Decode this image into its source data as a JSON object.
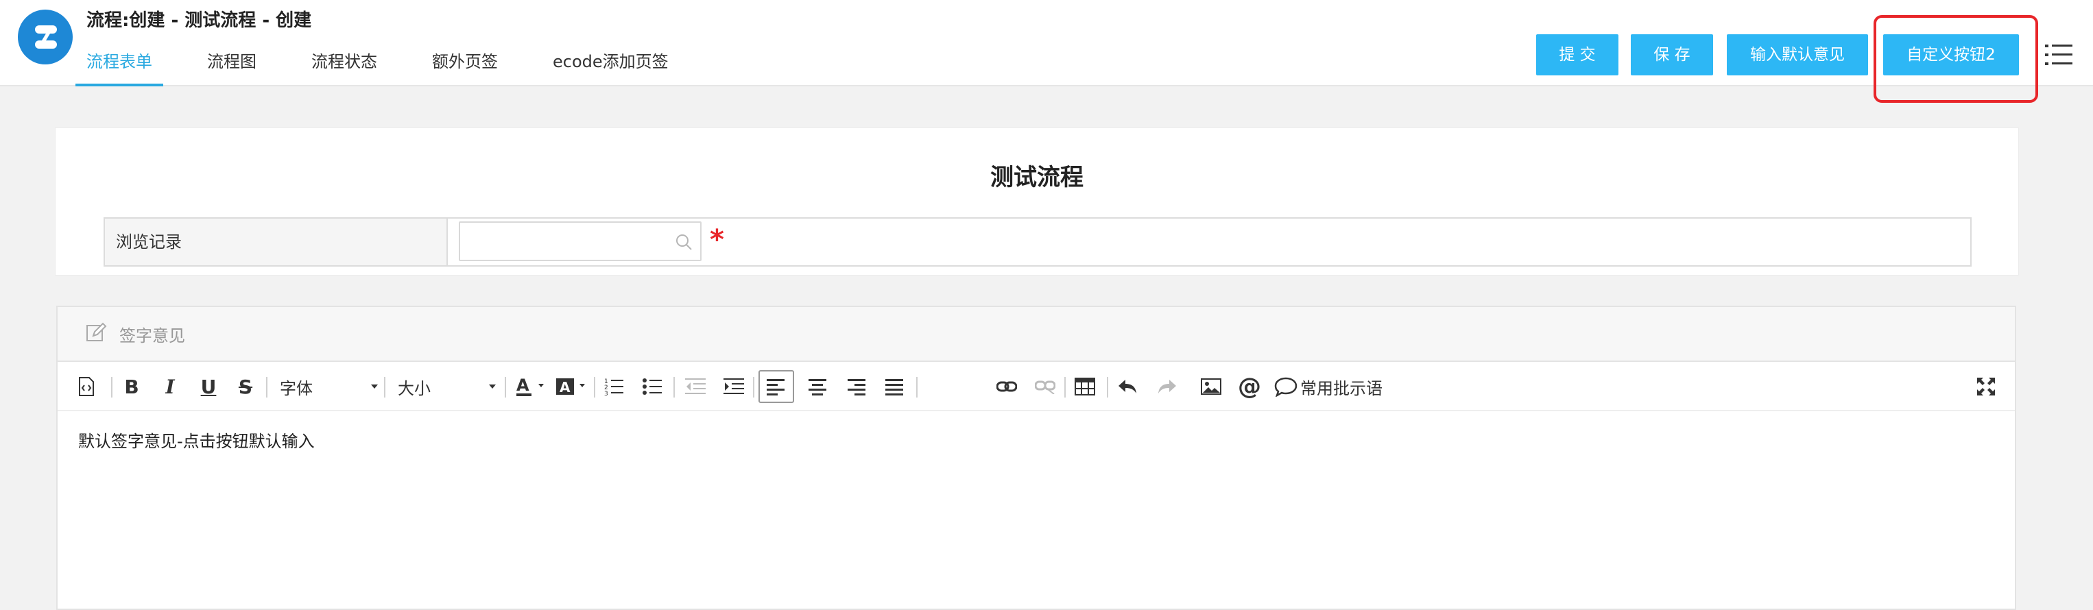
{
  "header": {
    "title": "流程:创建 - 测试流程 - 创建",
    "tabs": [
      {
        "label": "流程表单",
        "active": true
      },
      {
        "label": "流程图",
        "active": false
      },
      {
        "label": "流程状态",
        "active": false
      },
      {
        "label": "额外页签",
        "active": false
      },
      {
        "label": "ecode添加页签",
        "active": false
      }
    ],
    "buttons": {
      "submit": "提 交",
      "save": "保 存",
      "default_opinion": "输入默认意见",
      "custom2": "自定义按钮2"
    },
    "accent_color": "#2db7f5",
    "highlight_color": "#e8262a"
  },
  "form": {
    "title": "测试流程",
    "rows": [
      {
        "label": "浏览记录",
        "value": "",
        "required": true
      }
    ]
  },
  "editor": {
    "header_label": "签字意见",
    "toolbar": {
      "font_label": "字体",
      "size_label": "大小",
      "common_phrases": "常用批示语"
    },
    "content": "默认签字意见-点击按钮默认输入"
  }
}
